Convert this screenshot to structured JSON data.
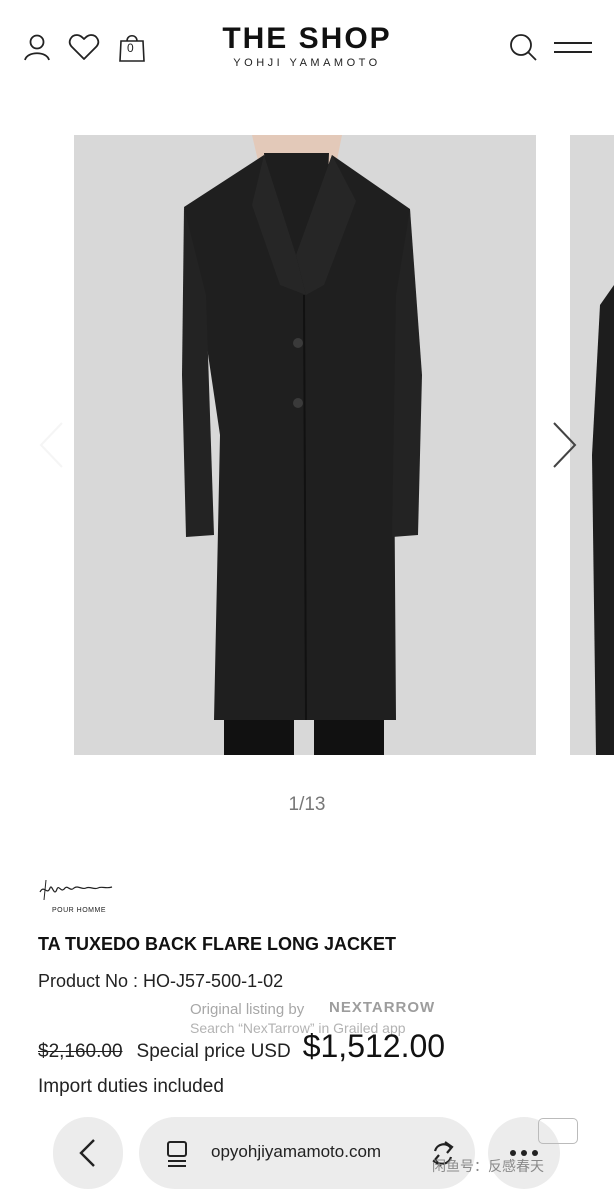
{
  "header": {
    "title": "THE SHOP",
    "subtitle": "YOHJI YAMAMOTO",
    "cart_count": "0",
    "icons": [
      "user-icon",
      "heart-icon",
      "shopping-bag-icon",
      "search-icon",
      "menu-icon"
    ]
  },
  "gallery": {
    "counter": "1/13"
  },
  "product": {
    "brand_sub": "POUR HOMME",
    "title": "TA TUXEDO BACK FLARE LONG JACKET",
    "product_no": "Product No : HO-J57-500-1-02",
    "original_price": "$2,160.00",
    "special_label": "Special price USD",
    "special_price": "$1,512.00",
    "duties": "Import duties included"
  },
  "watermark": {
    "line1": "Original listing by",
    "brand": "NEXTARROW",
    "line2": "Search “NexTarrow” in Grailed app",
    "corner": "闲鱼号：反感春天"
  },
  "browser": {
    "url": "opyohjiyamamoto.com"
  }
}
